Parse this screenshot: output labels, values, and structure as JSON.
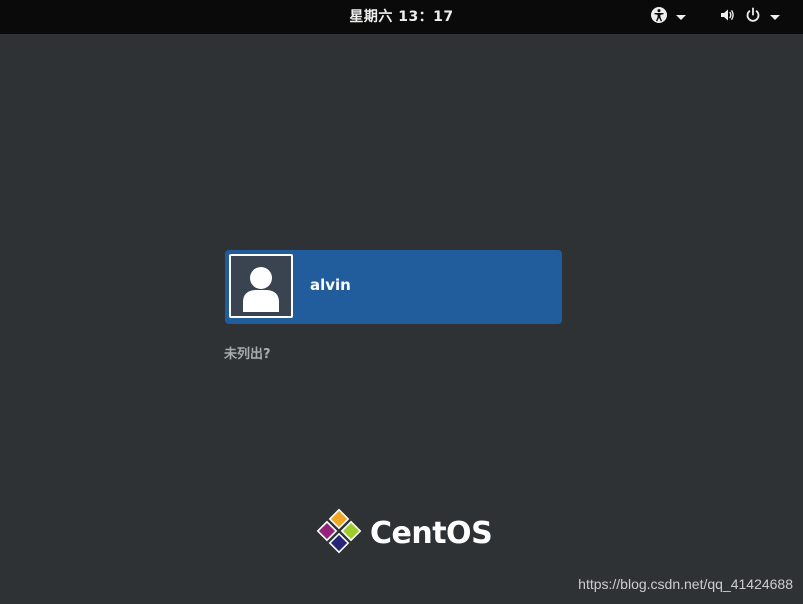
{
  "topbar": {
    "clock": "星期六 13：17",
    "accessibility_icon": "accessibility-icon",
    "volume_icon": "volume-icon",
    "power_icon": "power-icon",
    "menu_arrow_icon": "chevron-down-icon"
  },
  "login": {
    "user": {
      "name": "alvin",
      "avatar_icon": "user-avatar-icon"
    },
    "not_listed": "未列出?"
  },
  "branding": {
    "logo_text": "CentOS",
    "logo_icon": "centos-logo-icon"
  },
  "watermark": "https://blog.csdn.net/qq_41424688",
  "colors": {
    "background": "#2e3235",
    "topbar": "#0a0a0a",
    "user_card": "#215d9c",
    "muted_text": "#a9acaf"
  }
}
